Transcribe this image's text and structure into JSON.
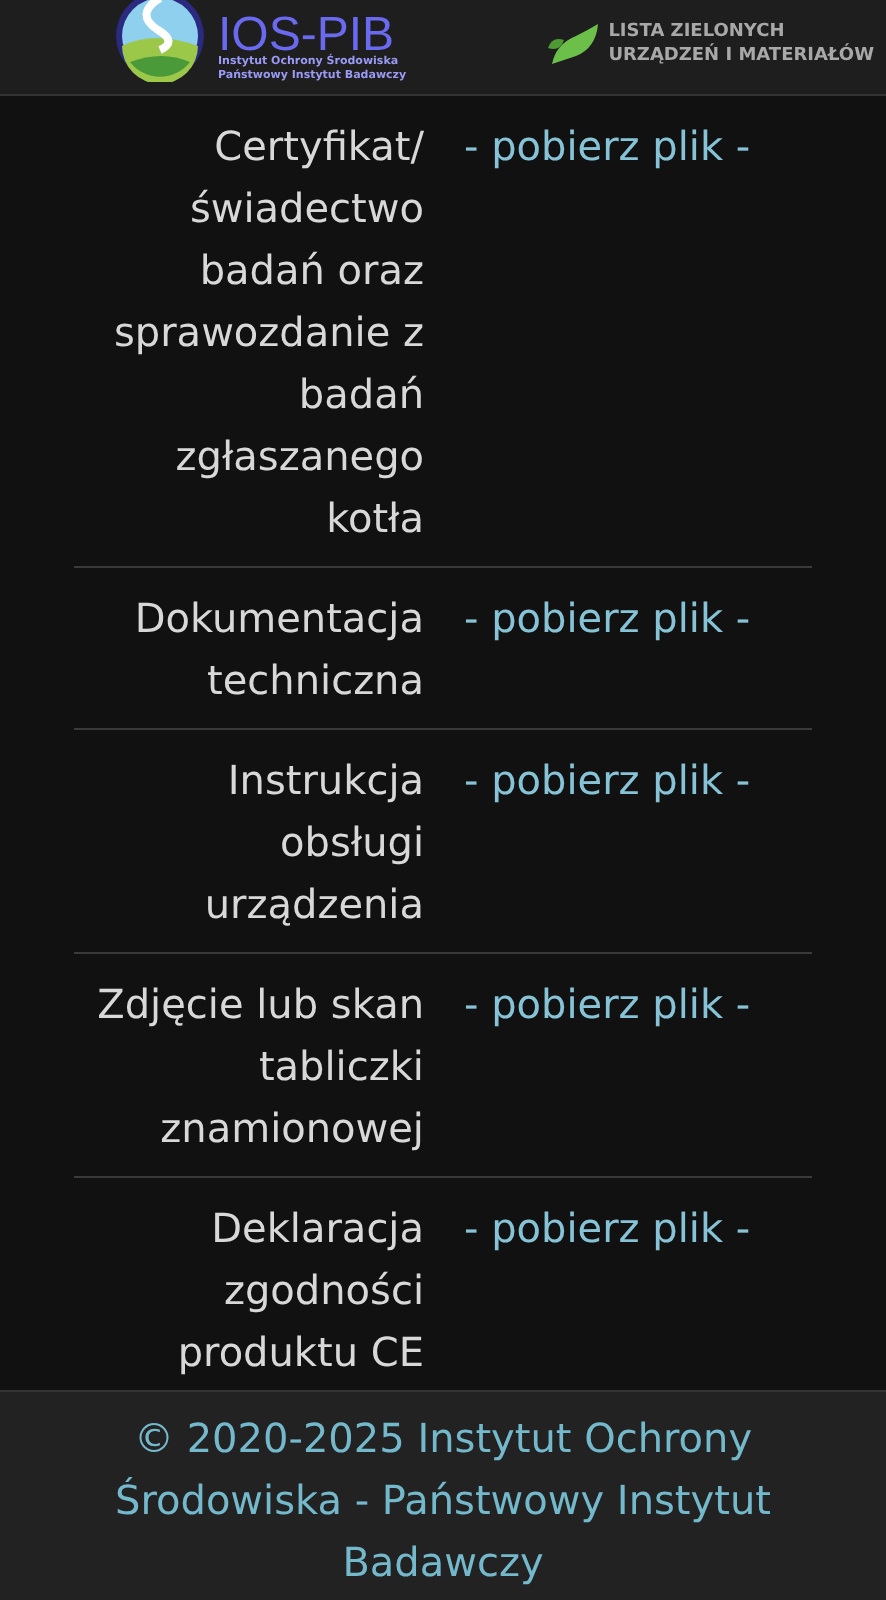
{
  "header": {
    "logo": {
      "title": "IOS-PIB",
      "subtitle": [
        "Instytut Ochrony Środowiska",
        "Państwowy Instytut Badawczy"
      ]
    },
    "list_title": [
      "LISTA ZIELONYCH",
      "URZĄDZEŃ I MATERIAŁÓW"
    ]
  },
  "documents": [
    {
      "label": "Certyfikat/ świadectwo badań oraz sprawozdanie z badań zgłaszanego kotła",
      "link": "- pobierz plik -"
    },
    {
      "label": "Dokumentacja techniczna",
      "link": "- pobierz plik -"
    },
    {
      "label": "Instrukcja obsługi urządzenia",
      "link": "- pobierz plik -"
    },
    {
      "label": "Zdjęcie lub skan tabliczki znamionowej",
      "link": "- pobierz plik -"
    },
    {
      "label": "Deklaracja zgodności produktu CE",
      "link": "- pobierz plik -"
    }
  ],
  "footer": {
    "text": "© 2020-2025 Instytut Ochrony Środowiska - Państwowy Instytut Badawczy"
  }
}
